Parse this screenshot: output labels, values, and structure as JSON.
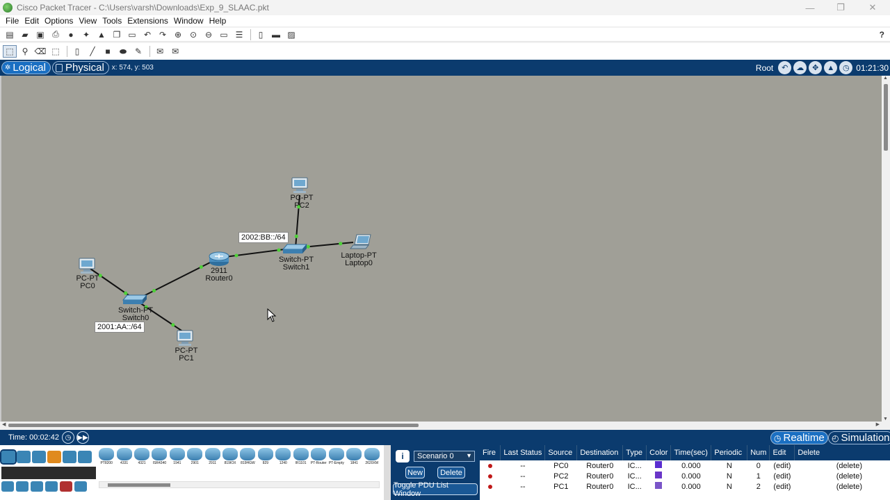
{
  "window": {
    "title": "Cisco Packet Tracer - C:\\Users\\varsh\\Downloads\\Exp_9_SLAAC.pkt",
    "minimize": "—",
    "maximize": "❐",
    "close": "✕"
  },
  "menu": [
    "File",
    "Edit",
    "Options",
    "View",
    "Tools",
    "Extensions",
    "Window",
    "Help"
  ],
  "toolbar": {
    "main_icons": [
      "new-file-icon",
      "open-folder-icon",
      "save-icon",
      "print-icon",
      "info-icon",
      "network-wizard-icon",
      "custom-device-icon",
      "copy-icon",
      "paste-icon",
      "undo-icon",
      "redo-icon",
      "zoom-in-icon",
      "zoom-reset-icon",
      "zoom-out-icon",
      "drawing-rectangle-icon",
      "custom-list-icon",
      "notes-icon",
      "device-dialog-icon",
      "screenshot-icon"
    ],
    "help": "?",
    "edit_icons": [
      "select-icon",
      "inspect-icon",
      "delete-icon",
      "resize-icon",
      "place-note-icon",
      "line-icon",
      "rectangle-icon",
      "ellipse-icon",
      "freeform-icon",
      "add-simple-pdu-icon",
      "add-complex-pdu-icon"
    ]
  },
  "workspace": {
    "logical_tab": "Logical",
    "physical_tab": "Physical",
    "coords": "x: 574, y: 503",
    "root": "Root",
    "clock": "01:21:30"
  },
  "topology": {
    "devices": [
      {
        "id": "pc2",
        "model": "PC-PT",
        "name": "PC2",
        "icon": "pc-icon"
      },
      {
        "id": "switch1",
        "model": "Switch-PT",
        "name": "Switch1",
        "icon": "switch-icon"
      },
      {
        "id": "laptop0",
        "model": "Laptop-PT",
        "name": "Laptop0",
        "icon": "laptop-icon"
      },
      {
        "id": "router0",
        "model": "2911",
        "name": "Router0",
        "icon": "router-icon"
      },
      {
        "id": "pc0",
        "model": "PC-PT",
        "name": "PC0",
        "icon": "pc-icon"
      },
      {
        "id": "switch0",
        "model": "Switch-PT",
        "name": "Switch0",
        "icon": "switch-icon"
      },
      {
        "id": "pc1",
        "model": "PC-PT",
        "name": "PC1",
        "icon": "pc-icon"
      }
    ],
    "links": [
      [
        "pc2",
        "switch1"
      ],
      [
        "switch1",
        "laptop0"
      ],
      [
        "router0",
        "switch1"
      ],
      [
        "router0",
        "switch0"
      ],
      [
        "pc0",
        "switch0"
      ],
      [
        "switch0",
        "pc1"
      ]
    ],
    "link_color": "#111111",
    "port_light_color": "#4fd13a",
    "notes": [
      "2002:BB::/64",
      "2001:AA::/64"
    ]
  },
  "bottom": {
    "time": "Time: 00:02:42",
    "realtime": "Realtime",
    "simulation": "Simulation",
    "device_models": [
      "PT8200",
      "4331",
      "4321",
      "ISR4340",
      "1941",
      "2901",
      "2911",
      "819IOX",
      "819HGW",
      "829",
      "1240",
      "IR1101",
      "PT-Router",
      "PT-Empty",
      "1841",
      "2620XM"
    ]
  },
  "scenario": {
    "selected": "Scenario 0",
    "new": "New",
    "delete": "Delete",
    "toggle": "Toggle PDU List Window",
    "info": "i"
  },
  "pdu": {
    "headers": [
      "Fire",
      "Last Status",
      "Source",
      "Destination",
      "Type",
      "Color",
      "Time(sec)",
      "Periodic",
      "Num",
      "Edit",
      "Delete"
    ],
    "rows": [
      {
        "last_status": "--",
        "source": "PC0",
        "destination": "Router0",
        "type": "IC...",
        "color": "#5a2ed0",
        "time": "0.000",
        "periodic": "N",
        "num": "0",
        "edit": "(edit)",
        "delete": "(delete)"
      },
      {
        "last_status": "--",
        "source": "PC2",
        "destination": "Router0",
        "type": "IC...",
        "color": "#6a36c8",
        "time": "0.000",
        "periodic": "N",
        "num": "1",
        "edit": "(edit)",
        "delete": "(delete)"
      },
      {
        "last_status": "--",
        "source": "PC1",
        "destination": "Router0",
        "type": "IC...",
        "color": "#7a55c8",
        "time": "0.000",
        "periodic": "N",
        "num": "2",
        "edit": "(edit)",
        "delete": "(delete)"
      }
    ]
  }
}
